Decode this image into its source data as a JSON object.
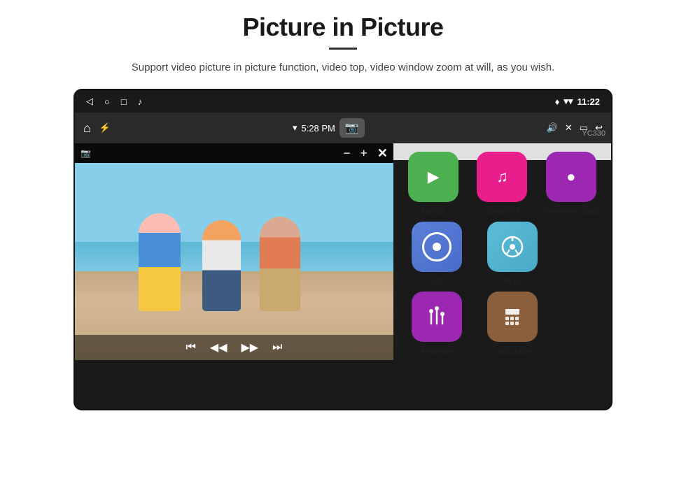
{
  "header": {
    "title": "Picture in Picture",
    "subtitle": "Support video picture in picture function, video top, video window zoom at will, as you wish."
  },
  "statusBar": {
    "time": "11:22",
    "icons": [
      "back",
      "home",
      "square",
      "music"
    ]
  },
  "appBar": {
    "time": "5:28 PM",
    "icons": [
      "home",
      "usb",
      "wifi",
      "camera",
      "volume",
      "close",
      "pip",
      "back"
    ]
  },
  "pipControls": {
    "minus": "−",
    "plus": "+",
    "close": "✕"
  },
  "videoControls": {
    "rewind": "⏮",
    "back": "◀◀",
    "forward": "▶▶",
    "next": "⏭"
  },
  "apps": {
    "row1": [
      {
        "label": "Netflix",
        "color": "green",
        "icon": "▶"
      },
      {
        "label": "SiriusXM",
        "color": "pink",
        "icon": "♫"
      },
      {
        "label": "Wheelkey Study",
        "color": "purple-light",
        "icon": "🔵"
      }
    ],
    "row2": [
      {
        "label": "DVR",
        "color": "blue",
        "icon": "dvr"
      },
      {
        "label": "AVIN",
        "color": "teal",
        "icon": "avin"
      }
    ],
    "row3": [
      {
        "label": "Amplifier",
        "color": "purple",
        "icon": "amp"
      },
      {
        "label": "Calculator",
        "color": "brown",
        "icon": "calc"
      }
    ]
  },
  "watermark": "YC330"
}
